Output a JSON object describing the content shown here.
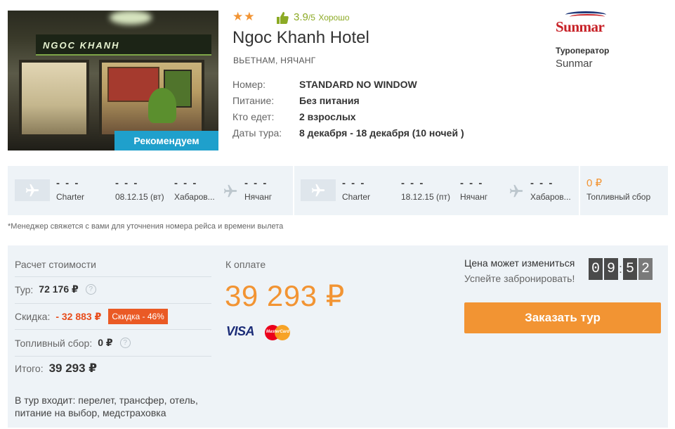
{
  "hotel": {
    "stars": "★★",
    "rating_score": "3.9",
    "rating_scale": "/5",
    "rating_text": "Хорошо",
    "name": "Ngoc Khanh Hotel",
    "location": "ВЬЕТНАМ, НЯЧАНГ",
    "photo_sign": "NGOC KHANH",
    "recommend_label": "Рекомендуем",
    "details": [
      {
        "label": "Номер:",
        "value": "STANDARD NO WINDOW"
      },
      {
        "label": "Питание:",
        "value": "Без питания"
      },
      {
        "label": "Кто едет:",
        "value": "2 взрослых"
      },
      {
        "label": "Даты тура:",
        "value": "8 декабря - 18 декабря (10 ночей )"
      }
    ]
  },
  "operator": {
    "logo_text": "Sunmar",
    "label": "Туроператор",
    "name": "Sunmar"
  },
  "flights": {
    "outbound": {
      "time_placeholder": "- - -",
      "airline": "Charter",
      "date": "08.12.15 (вт)",
      "from": "Хабаров...",
      "to": "Нячанг"
    },
    "inbound": {
      "time_placeholder": "- - -",
      "airline": "Charter",
      "date": "18.12.15 (пт)",
      "from": "Нячанг",
      "to": "Хабаров..."
    },
    "fuel_price": "0 ₽",
    "fuel_label": "Топливный сбор"
  },
  "note": "*Менеджер свяжется с вами для уточнения номера рейса и времени вылета",
  "calc": {
    "title": "Расчет стоимости",
    "tour_label": "Тур:",
    "tour_value": "72 176 ₽",
    "discount_label": "Скидка:",
    "discount_value": "- 32 883 ₽",
    "discount_badge": "Скидка - 46%",
    "fuel_label": "Топливный сбор:",
    "fuel_value": "0 ₽",
    "total_label": "Итого:",
    "total_value": "39 293 ₽",
    "includes": "В тур входит: перелет, трансфер, отель, питание на выбор, медстраховка"
  },
  "payment": {
    "label": "К оплате",
    "amount": "39 293 ₽",
    "visa": "VISA",
    "mastercard": "MasterCard"
  },
  "booking": {
    "warning": "Цена может измениться",
    "cta_text": "Успейте забронировать!",
    "timer": {
      "d1": "0",
      "d2": "9",
      "d3": "5",
      "d4": "2"
    },
    "button": "Заказать тур"
  },
  "colors": {
    "accent_orange": "#f29433",
    "discount_red": "#ea5a25",
    "recommend_blue": "#1fa0cc",
    "rating_green": "#8caa25"
  }
}
